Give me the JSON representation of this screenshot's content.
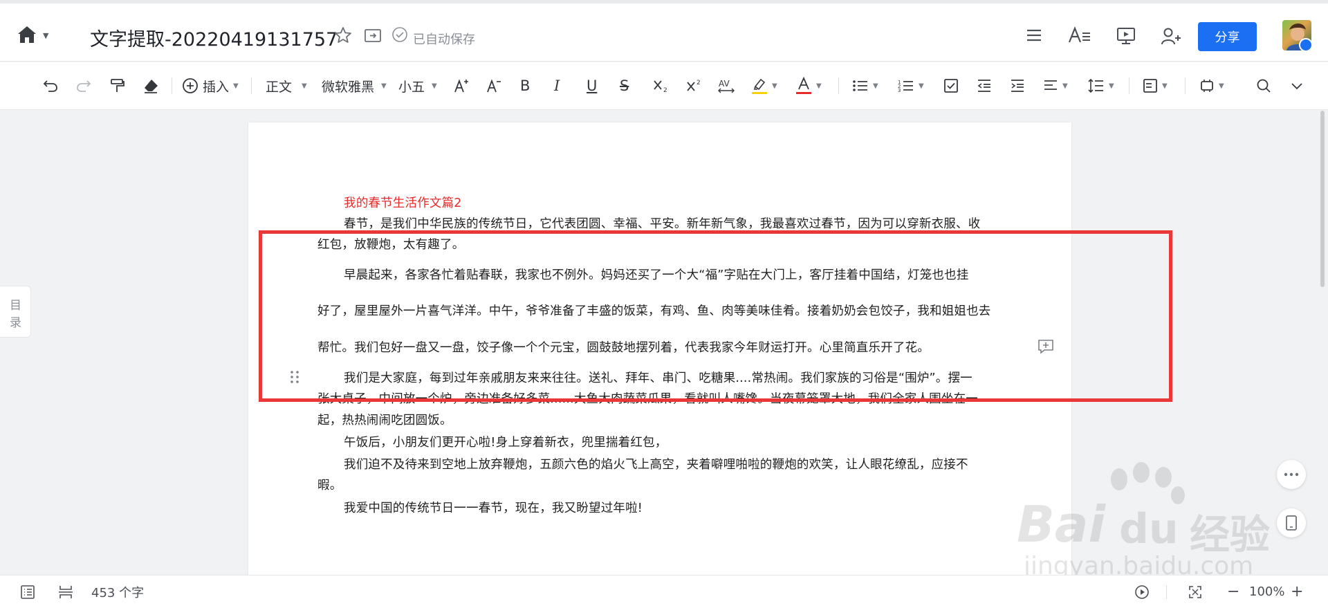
{
  "header": {
    "doc_title": "文字提取-20220419131757",
    "autosave_text": "已自动保存",
    "share_label": "分享"
  },
  "toolbar": {
    "insert_label": "插入",
    "style_value": "正文",
    "font_value": "微软雅黑",
    "size_value": "小五",
    "bold": "B",
    "italic": "I",
    "underline": "U",
    "strike": "S",
    "text_color_accent": "#e52b2b",
    "highlight_accent": "#f5d20a"
  },
  "sidebar": {
    "toc_line1": "目",
    "toc_line2": "录"
  },
  "document": {
    "heading": "我的春节生活作文篇2",
    "paragraphs": [
      "春节，是我们中华民族的传统节日，它代表团圆、幸福、平安。新年新气象，我最喜欢过春节，因为可以穿新衣服、收",
      "红包，放鞭炮，太有趣了。",
      "早晨起来，各家各忙着贴春联，我家也不例外。妈妈还买了一个大“福”字贴在大门上，客厅挂着中国结，灯笼也也挂",
      "好了，屋里屋外一片喜气洋洋。中午，爷爷准备了丰盛的饭菜，有鸡、鱼、肉等美味佳肴。接着奶奶会包饺子，我和姐姐也去",
      "帮忙。我们包好一盘又一盘，饺子像一个个元宝，圆鼓鼓地摆列着，代表我家今年财运打开。心里简直乐开了花。",
      "我们是大家庭，每到过年亲戚朋友来来往往。送礼、拜年、串门、吃糖果....常热闹。我们家族的习俗是“围炉”。摆一",
      "张大桌子，中间放一个炉，旁边准备好多菜......大鱼大肉蔬菜瓜果，看就叫人嘴馋。当夜幕笼罩大地，我们全家人围坐在一",
      "起，热热闹闹吃团圆饭。",
      "午饭后，小朋友们更开心啦!身上穿着新衣，兜里揣着红包，",
      "我们迫不及待来到空地上放弃鞭炮，五颜六色的焰火飞上高空，夹着噼哩啪啦的鞭炮的欢笑，让人眼花缭乱，应接不",
      "暇。",
      "我爱中国的传统节日一一春节，现在，我又盼望过年啦!"
    ]
  },
  "status": {
    "word_count": "453 个字",
    "zoom": "100%"
  },
  "watermark": {
    "brand": "Bai",
    "brand2": "du",
    "cn": "经验",
    "url": "jingyan.baidu.com"
  }
}
